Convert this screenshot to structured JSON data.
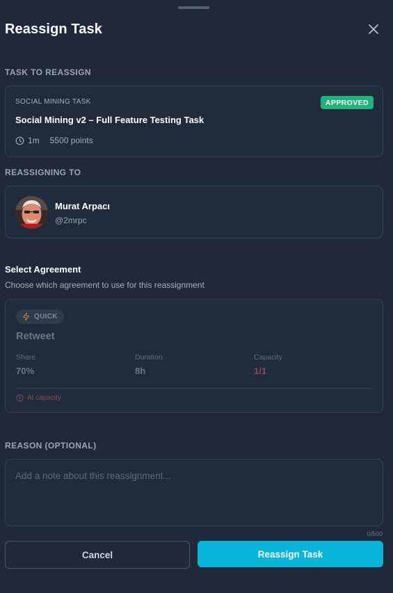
{
  "dialog": {
    "title": "Reassign Task",
    "close_icon": "close-icon"
  },
  "task_section": {
    "label": "TASK TO REASSIGN",
    "type": "SOCIAL MINING TASK",
    "status": "APPROVED",
    "status_color": "#1fb57a",
    "title": "Social Mining v2 – Full Feature Testing Task",
    "duration": "1m",
    "points": "5500 points",
    "clock_icon": "clock-icon"
  },
  "assignee_section": {
    "label": "REASSIGNING TO",
    "name": "Murat Arpacı",
    "handle": "@2mrpc"
  },
  "agreement_section": {
    "heading": "Select Agreement",
    "subheading": "Choose which agreement to use for this reassignment",
    "agreement": {
      "badge": "QUICK",
      "badge_icon": "lightning-icon",
      "name": "Retweet",
      "share_label": "Share",
      "share_value": "70%",
      "duration_label": "Duration",
      "duration_value": "8h",
      "capacity_label": "Capacity",
      "capacity_value": "1/1",
      "warning": "At capacity",
      "warning_icon": "alert-circle-icon",
      "warning_color": "#8e4a55"
    }
  },
  "reason_section": {
    "label": "REASON (OPTIONAL)",
    "placeholder": "Add a note about this reassignment...",
    "value": "",
    "char_count": "0/500"
  },
  "actions": {
    "cancel_label": "Cancel",
    "submit_label": "Reassign Task",
    "primary_color": "#08b4d7"
  }
}
